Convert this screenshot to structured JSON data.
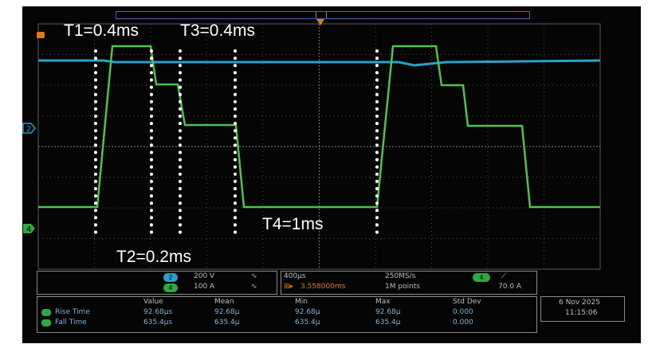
{
  "annotations": {
    "t1": "T1=0.4ms",
    "t3": "T3=0.4ms",
    "t2": "T2=0.2ms",
    "t4": "T4=1ms"
  },
  "channels": {
    "ch2": {
      "number": "2",
      "scale": "200 V",
      "color": "#2aa1c8"
    },
    "ch4": {
      "number": "4",
      "scale": "100 A",
      "color": "#2ea843"
    }
  },
  "timebase": {
    "scale": "400μs",
    "sample_rate": "250MS/s",
    "position": "3.558000ms",
    "record": "1M points"
  },
  "trigger": {
    "channel": "4",
    "slope_symbol": "⟋",
    "level": "70.0 A"
  },
  "measurements": {
    "headers": [
      "Value",
      "Mean",
      "Min",
      "Max",
      "Std Dev"
    ],
    "rows": [
      {
        "channel": "4",
        "label": "Rise Time",
        "values": [
          "92.68μs",
          "92.68μ",
          "92.68μ",
          "92.68μ",
          "0.000"
        ]
      },
      {
        "channel": "4",
        "label": "Fall Time",
        "values": [
          "635.4μs",
          "635.4μ",
          "635.4μ",
          "635.4μ",
          "0.000"
        ]
      }
    ]
  },
  "datetime": {
    "date": "6 Nov 2025",
    "time": "11:15:06"
  },
  "colors": {
    "ch2_trace": "#2aa1c8",
    "ch4_trace": "#4fc24d",
    "annotation": "#ffffff",
    "grid": "#6e6e6e",
    "trigger_marker": "#e07a1a"
  }
}
